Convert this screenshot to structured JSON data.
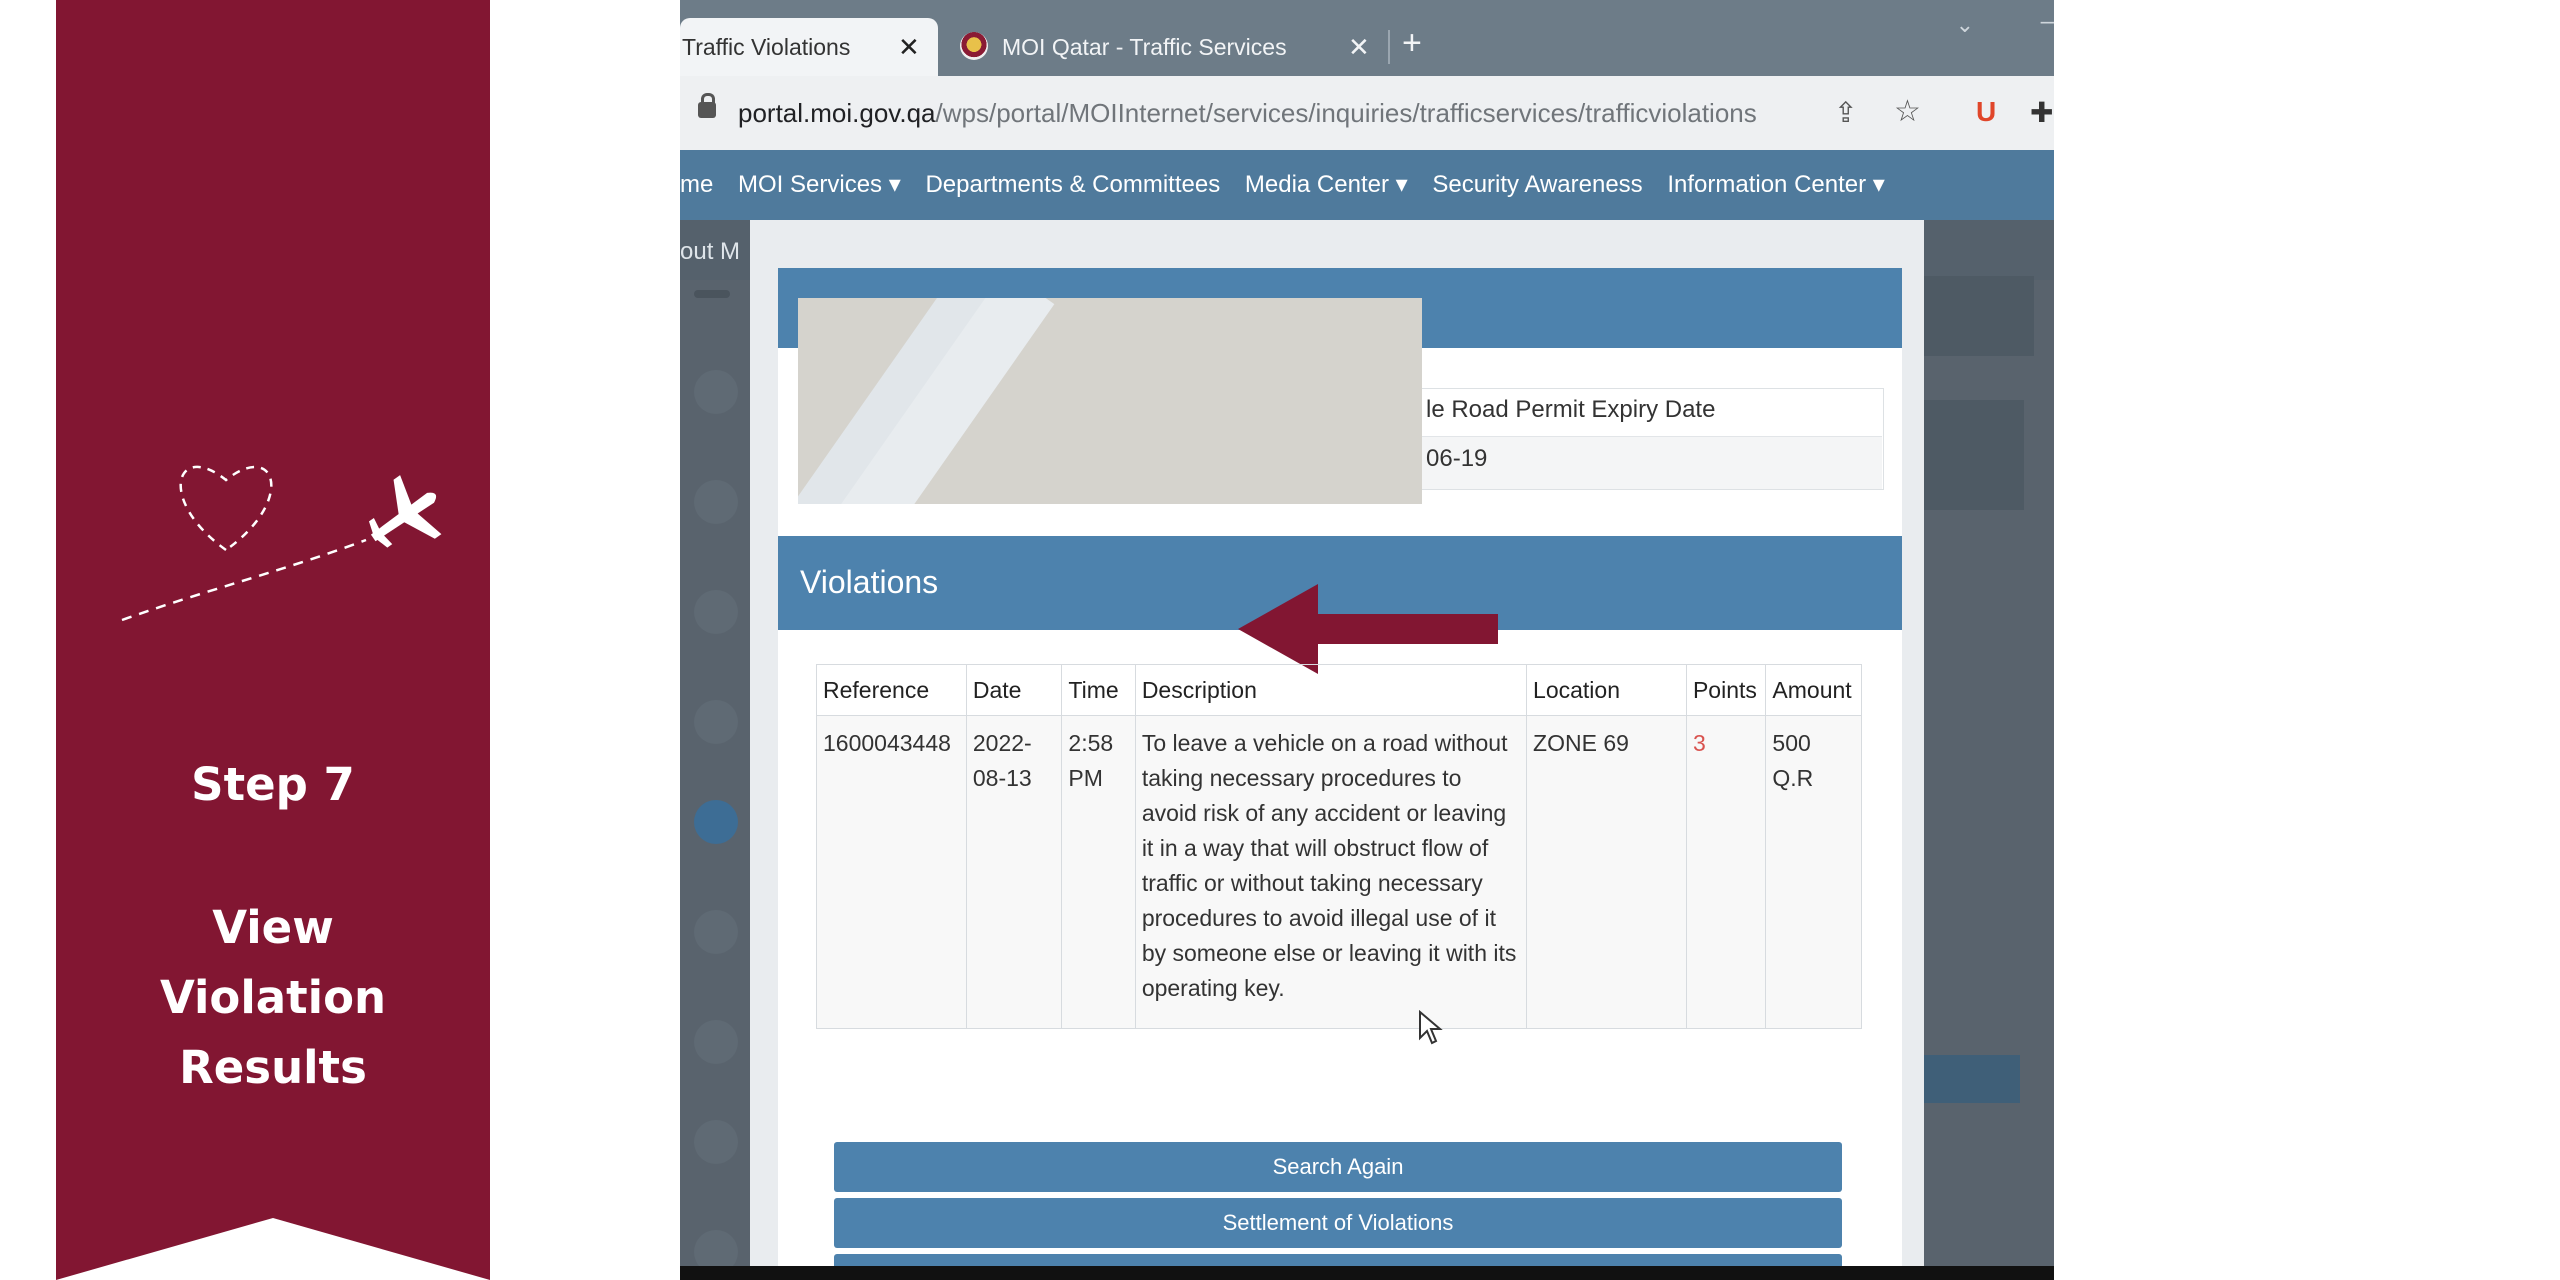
{
  "banner": {
    "step": "Step 7",
    "title": "View Violation Results",
    "color": "#821632"
  },
  "browser": {
    "tabs": [
      {
        "title": "Traffic Violations",
        "active": true
      },
      {
        "title": "MOI Qatar - Traffic Services",
        "active": false
      }
    ],
    "url_host": "portal.moi.gov.qa",
    "url_path": "/wps/portal/MOIInternet/services/inquiries/trafficservices/trafficviolations",
    "extension_label": "U"
  },
  "nav": {
    "items": [
      "me",
      "MOI Services ▾",
      "Departments & Committees",
      "Media Center ▾",
      "Security Awareness",
      "Information Center ▾"
    ],
    "sub": "out M"
  },
  "modal": {
    "permit_label": "le Road Permit Expiry Date",
    "permit_value": "06-19",
    "violations_title": "Violations",
    "table": {
      "headers": [
        "Reference",
        "Date",
        "Time",
        "Description",
        "Location",
        "Points",
        "Amount"
      ],
      "row": {
        "reference": "1600043448",
        "date": "2022-08-13",
        "time": "2:58 PM",
        "description": "To leave a vehicle on a road without taking necessary procedures to avoid risk of any accident or leaving it in a way that will obstruct flow of traffic or without taking necessary procedures to avoid illegal use of it by someone else or leaving it with its operating key.",
        "location": "ZONE 69",
        "points": "3",
        "amount": "500 Q.R"
      }
    },
    "buttons": {
      "search_again": "Search Again",
      "settlement": "Settlement of Violations"
    }
  },
  "colors": {
    "accent_blue": "#4d82ad",
    "arrow": "#821632"
  }
}
